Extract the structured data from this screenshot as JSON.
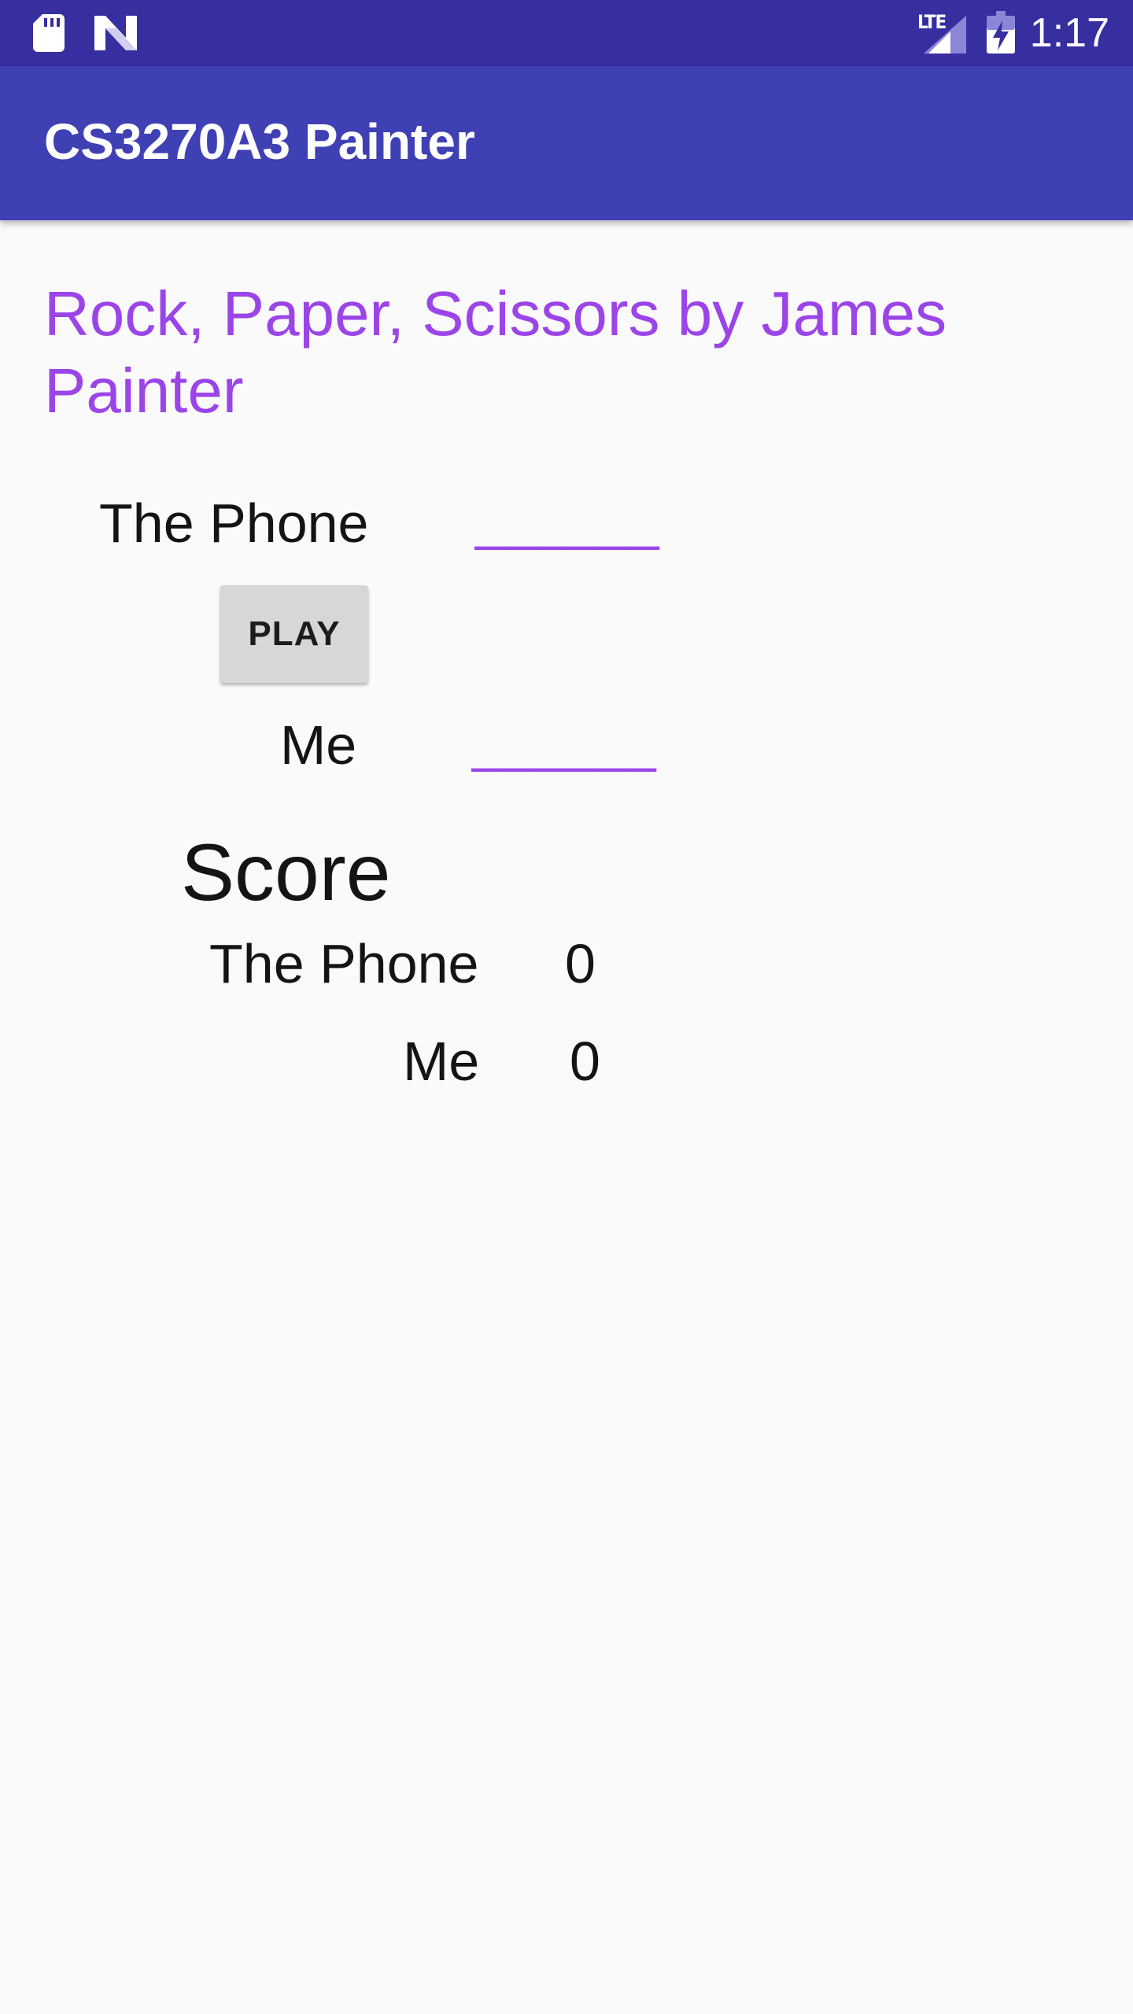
{
  "status_bar": {
    "time": "1:17",
    "network": "LTE",
    "icons": [
      "sd-card-icon",
      "n-logo-icon",
      "signal-icon",
      "battery-charging-icon"
    ]
  },
  "app_bar": {
    "title": "CS3270A3 Painter"
  },
  "main": {
    "heading": "Rock, Paper, Scissors by James Painter",
    "phone_label": "The Phone",
    "phone_choice": "______",
    "play_button": "PLAY",
    "me_label": "Me",
    "me_choice": "______"
  },
  "score": {
    "title": "Score",
    "phone_label": "The Phone",
    "phone_value": "0",
    "me_label": "Me",
    "me_value": "0"
  },
  "colors": {
    "status_bar": "#372fa0",
    "app_bar": "#4040b5",
    "accent": "#9b45e8",
    "background": "#fafafa",
    "button": "#d6d7d7"
  }
}
